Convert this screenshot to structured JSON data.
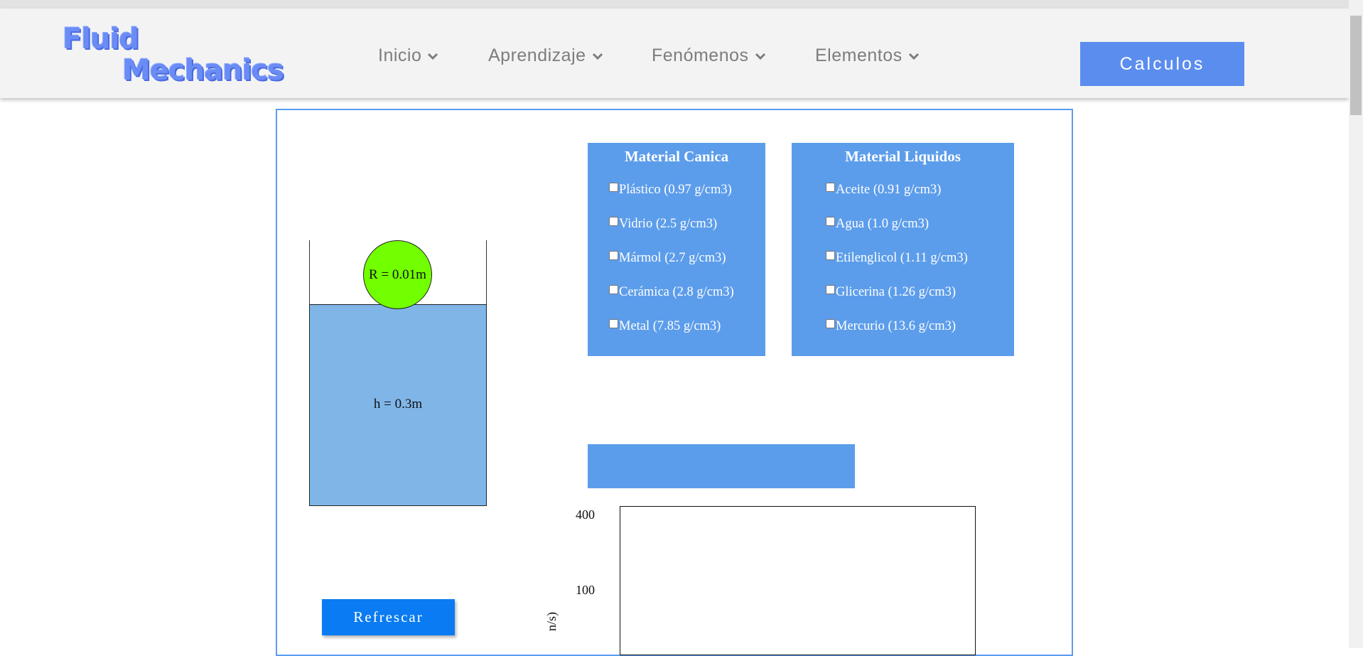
{
  "logo": {
    "line1": "Fluid",
    "line2": "Mechanics"
  },
  "nav": {
    "items": [
      {
        "label": "Inicio"
      },
      {
        "label": "Aprendizaje"
      },
      {
        "label": "Fenómenos"
      },
      {
        "label": "Elementos"
      }
    ],
    "cta_label": "Calculos"
  },
  "simulation": {
    "marble_radius_label": "R = 0.01m",
    "liquid_height_label": "h = 0.3m",
    "refresh_label": "Refrescar"
  },
  "materials": {
    "marble": {
      "title": "Material Canica",
      "options": [
        {
          "label": "Plástico (0.97 g/cm3)",
          "checked": false
        },
        {
          "label": "Vidrio (2.5 g/cm3)",
          "checked": false
        },
        {
          "label": "Mármol (2.7 g/cm3)",
          "checked": false
        },
        {
          "label": "Cerámica (2.8 g/cm3)",
          "checked": false
        },
        {
          "label": "Metal (7.85 g/cm3)",
          "checked": false
        }
      ]
    },
    "liquid": {
      "title": "Material Liquidos",
      "options": [
        {
          "label": "Aceite (0.91 g/cm3)",
          "checked": false
        },
        {
          "label": "Agua (1.0 g/cm3)",
          "checked": false
        },
        {
          "label": "Etilenglicol (1.11 g/cm3)",
          "checked": false
        },
        {
          "label": "Glicerina (1.26 g/cm3)",
          "checked": false
        },
        {
          "label": "Mercurio (13.6 g/cm3)",
          "checked": false
        }
      ]
    }
  },
  "graph": {
    "y_ticks": [
      "400",
      "100"
    ],
    "y_label_partial": "n/s)"
  },
  "colors": {
    "accent": "#5b8def",
    "panel": "#5c9deb",
    "water": "#80b5e8",
    "marble": "#72ff00",
    "button": "#0a7bf2"
  }
}
